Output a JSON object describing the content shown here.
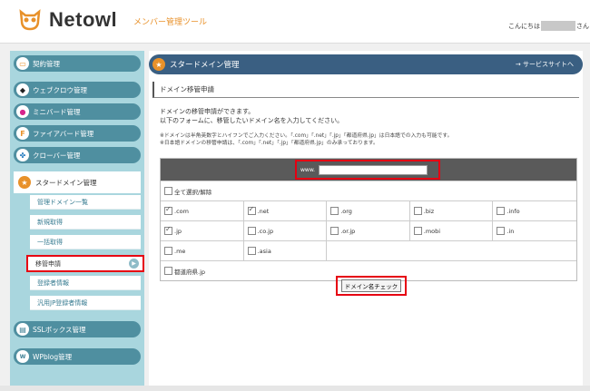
{
  "header": {
    "brand": "Netowl",
    "tool_name": "メンバー管理ツール",
    "greeting_prefix": "こんにちは",
    "greeting_suffix": "さん"
  },
  "sidebar": {
    "items": [
      {
        "label": "契約管理",
        "icon": "contract-icon"
      },
      {
        "label": "ウェブクロウ管理",
        "icon": "webcrow-icon"
      },
      {
        "label": "ミニバード管理",
        "icon": "minibird-icon"
      },
      {
        "label": "ファイアバード管理",
        "icon": "firebird-icon"
      },
      {
        "label": "クローバー管理",
        "icon": "clover-icon"
      },
      {
        "label": "スタードメイン管理",
        "icon": "stardomain-icon"
      },
      {
        "label": "SSLボックス管理",
        "icon": "sslbox-icon"
      },
      {
        "label": "WPblog管理",
        "icon": "wpblog-icon"
      }
    ],
    "sub_items": [
      {
        "label": "管理ドメイン一覧"
      },
      {
        "label": "新規取得"
      },
      {
        "label": "一括取得"
      },
      {
        "label": "移管申請"
      },
      {
        "label": "登録者情報"
      },
      {
        "label": "汎用JP登録者情報"
      }
    ]
  },
  "main": {
    "title": "スタードメイン管理",
    "service_link": "→ サービスサイトへ",
    "section_title": "ドメイン移管申請",
    "desc_line1": "ドメインの移管申請ができます。",
    "desc_line2": "以下のフォームに、移管したいドメイン名を入力してください。",
    "note_line1": "※ドメインは半角英数字とハイフンでご入力ください。「.com」「.net」「.jp」「都道府県.jp」は日本語での入力も可能です。",
    "note_line2": "※日本語ドメインの移管申請は、「.com」「.net」「.jp」「都道府県.jp」のみ承っております。",
    "www_label": "www.",
    "www_value": "",
    "select_all": "全て選択/解除",
    "tlds_row1": [
      {
        "label": ".com",
        "checked": true
      },
      {
        "label": ".net",
        "checked": true
      },
      {
        "label": ".org",
        "checked": false
      },
      {
        "label": ".biz",
        "checked": false
      },
      {
        "label": ".info",
        "checked": false
      }
    ],
    "tlds_row2": [
      {
        "label": ".jp",
        "checked": true
      },
      {
        "label": ".co.jp",
        "checked": false
      },
      {
        "label": ".or.jp",
        "checked": false
      },
      {
        "label": ".mobi",
        "checked": false
      },
      {
        "label": ".in",
        "checked": false
      }
    ],
    "tlds_row3": [
      {
        "label": ".me",
        "checked": false
      },
      {
        "label": ".asia",
        "checked": false
      }
    ],
    "pref_jp": "都道府県.jp",
    "check_button": "ドメイン名チェック"
  },
  "colors": {
    "accent": "#e8912a",
    "highlight": "#e60012",
    "header_bar": "#3a5f82",
    "sidebar_bg": "#a9d6de"
  }
}
